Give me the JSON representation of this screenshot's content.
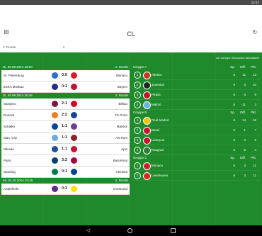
{
  "status": {
    "time": "12:27"
  },
  "app": {
    "title": "CL"
  },
  "round_select": {
    "value": "2. Runde"
  },
  "update_note": "Vor wenigen Sekunden aktualisiert",
  "colors": {
    "green": "#1f8a2c",
    "statusbar": "#4a4a4a"
  },
  "days": [
    {
      "date": "Di, 30.09.2014 18:00",
      "round": "2. Runde",
      "matches": [
        {
          "home": "St. Petersburg",
          "away": "Monaco",
          "score": "0:0",
          "home_color": "#2a6fc9",
          "away_color": "#d21f2b"
        },
        {
          "home": "ZSKA Moskau",
          "away": "Bayern",
          "score": "0:1",
          "home_color": "#1a2f8a",
          "away_color": "#c8102e"
        }
      ]
    },
    {
      "date": "Di, 30.09.2014 20:45",
      "round": "2. Runde",
      "matches": [
        {
          "home": "Sarajevo",
          "away": "Bilbao",
          "score": "2:1",
          "home_color": "#7a1a3a",
          "away_color": "#d10a1e"
        },
        {
          "home": "Donezk",
          "away": "FC Porto",
          "score": "2:2",
          "home_color": "#f47b20",
          "away_color": "#1a3f95"
        },
        {
          "home": "Schalke",
          "away": "Maribor",
          "score": "1:1",
          "home_color": "#0046a0",
          "away_color": "#6a3c9a"
        },
        {
          "home": "Man. City",
          "away": "AS Rom",
          "score": "1:1",
          "home_color": "#6cabdd",
          "away_color": "#8e1f2f"
        },
        {
          "home": "Nikosia",
          "away": "Ajax",
          "score": "1:1",
          "home_color": "#1d4f9c",
          "away_color": "#c8102e"
        },
        {
          "home": "Paris",
          "away": "Barcelona",
          "score": "3:2",
          "home_color": "#004170",
          "away_color": "#a50044"
        },
        {
          "home": "Sporting",
          "away": "Chelsea",
          "score": "0:1",
          "home_color": "#00794a",
          "away_color": "#034694"
        }
      ]
    },
    {
      "date": "Mi, 01.10.2014 20:45",
      "round": "2. Runde",
      "matches": [
        {
          "home": "Anderlecht",
          "away": "Dortmund",
          "score": "0:3",
          "home_color": "#5b2d8e",
          "away_color": "#fde100"
        }
      ]
    }
  ],
  "table_headers": {
    "sp": "Sp.",
    "diff": "Diff.",
    "pkt": "Pkt."
  },
  "groups": [
    {
      "name": "Gruppe A",
      "teams": [
        {
          "rank": "1",
          "name": "Atletico",
          "sp": "6",
          "diff": "11",
          "pkt": "13",
          "color": "#cb3524"
        },
        {
          "rank": "2",
          "name": "Juventus",
          "sp": "6",
          "diff": "3",
          "pkt": "10",
          "color": "#222222"
        },
        {
          "rank": "3",
          "name": "Piräus",
          "sp": "6",
          "diff": "-3",
          "pkt": "9",
          "color": "#c8102e"
        },
        {
          "rank": "4",
          "name": "Malmö",
          "sp": "6",
          "diff": "-11",
          "pkt": "3",
          "color": "#6ab1e1"
        }
      ]
    },
    {
      "name": "Gruppe B",
      "teams": [
        {
          "rank": "1",
          "name": "Real Madrid",
          "sp": "6",
          "diff": "14",
          "pkt": "18",
          "color": "#f2c200"
        },
        {
          "rank": "2",
          "name": "Basel",
          "sp": "6",
          "diff": "-1",
          "pkt": "7",
          "color": "#c8102e"
        },
        {
          "rank": "3",
          "name": "Liverpool",
          "sp": "6",
          "diff": "-4",
          "pkt": "5",
          "color": "#c8102e"
        },
        {
          "rank": "4",
          "name": "Rasgrad",
          "sp": "6",
          "diff": "-9",
          "pkt": "4",
          "color": "#2e7d32"
        }
      ]
    },
    {
      "name": "Gruppe C",
      "teams": [
        {
          "rank": "1",
          "name": "Monaco",
          "sp": "6",
          "diff": "3",
          "pkt": "11",
          "color": "#d21f2b"
        },
        {
          "rank": "2",
          "name": "Leverkusen",
          "sp": "6",
          "diff": "3",
          "pkt": "11",
          "color": "#e32219"
        }
      ]
    }
  ]
}
